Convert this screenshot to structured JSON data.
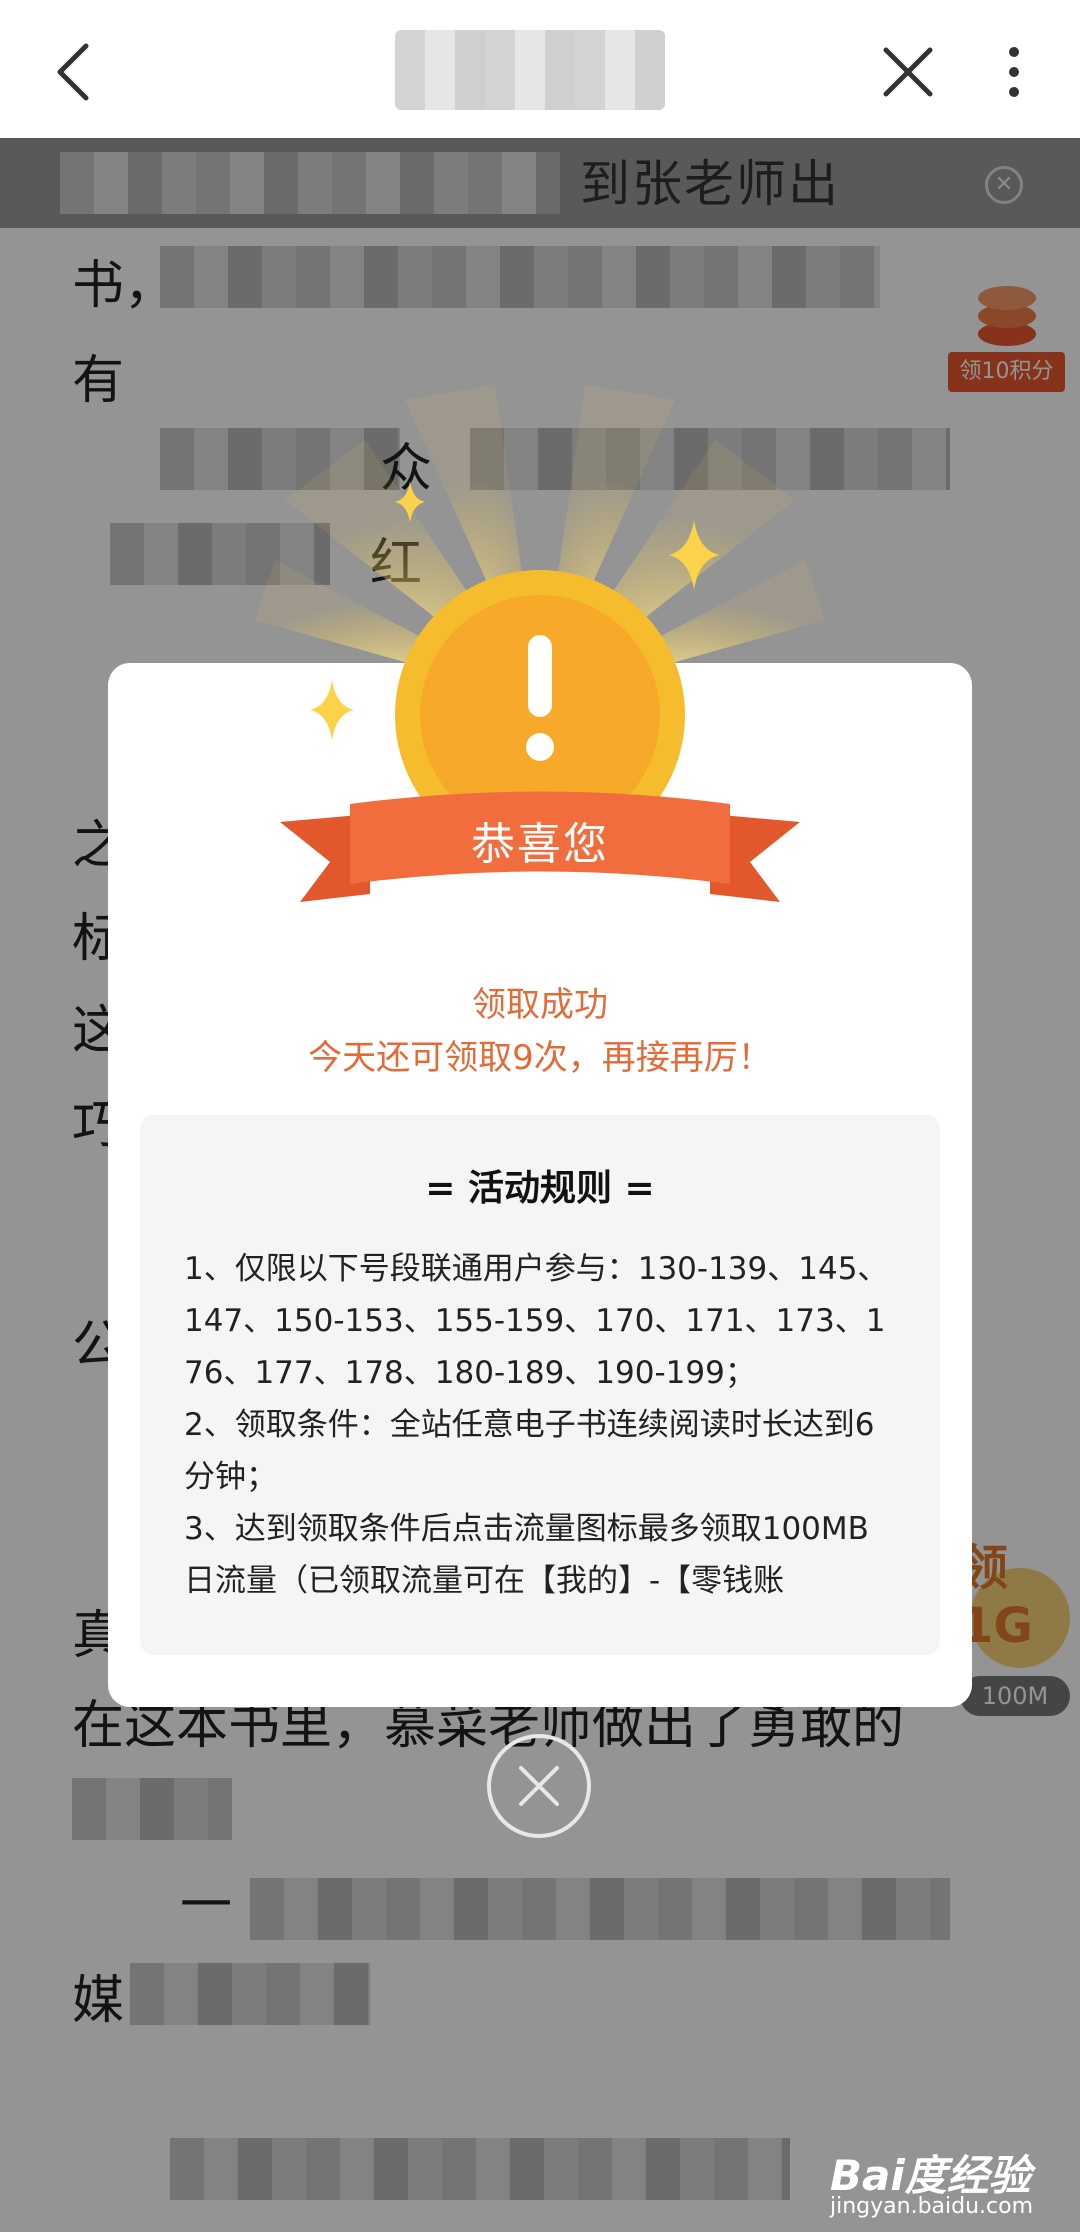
{
  "nav": {
    "back_icon": "back-chevron-icon",
    "close_icon": "close-x-icon",
    "more_icon": "vertical-dots-icon"
  },
  "article": {
    "promo_partial": "到张老师出",
    "lines": [
      "书，",
      "有",
      "众",
      "红",
      "之",
      "标",
      "这",
      "巧",
      "公",
      "真",
      "在这本书里，慕菜老师做出了勇敢的",
      "一",
      "媒"
    ],
    "side_coin_badge": "领10积分",
    "side_flow_title": "领1G",
    "side_flow_badge": "100M"
  },
  "popup": {
    "ribbon_text": "恭喜您",
    "success_text": "领取成功",
    "remain_text": "今天还可领取9次，再接再厉！",
    "rules": {
      "title": "= 活动规则 =",
      "items": [
        "1、仅限以下号段联通用户参与：130-139、145、147、150-153、155-159、170、171、173、176、177、178、180-189、190-199；",
        "2、领取条件：全站任意电子书连续阅读时长达到6分钟；",
        "3、达到领取条件后点击流量图标最多领取100MB日流量（已领取流量可在【我的】-【零钱账"
      ]
    },
    "close_icon": "close-circle-icon"
  },
  "watermark": {
    "logo": "Bai度经验",
    "url": "jingyan.baidu.com"
  },
  "colors": {
    "accent": "#e46a36",
    "ribbon": "#f06b3a",
    "medal": "#f5bd2e",
    "badge": "#e8572d"
  }
}
